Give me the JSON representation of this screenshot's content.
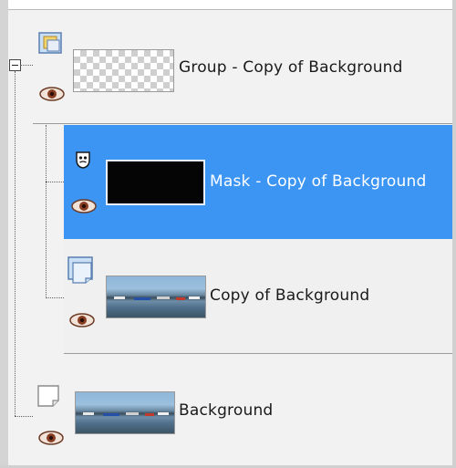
{
  "layers": [
    {
      "id": "group",
      "name": "Group - Copy of Background",
      "type_icon": "group-layer-icon",
      "visible_icon": "eye-icon",
      "thumbnail": "transparent-checker",
      "selected": false,
      "expanded": true
    },
    {
      "id": "mask",
      "name": "Mask - Copy of Background",
      "type_icon": "mask-layer-icon",
      "visible_icon": "eye-icon",
      "thumbnail": "black",
      "selected": true
    },
    {
      "id": "copy",
      "name": "Copy of Background",
      "type_icon": "raster-layer-icon",
      "visible_icon": "eye-icon",
      "thumbnail": "harbor-photo",
      "selected": false
    },
    {
      "id": "background",
      "name": "Background",
      "type_icon": "raster-layer-icon",
      "visible_icon": "eye-icon",
      "thumbnail": "harbor-photo",
      "selected": false
    }
  ],
  "colors": {
    "selection": "#3d95f3",
    "row_background": "#f2f2f2",
    "separator": "#9a9a9a"
  }
}
